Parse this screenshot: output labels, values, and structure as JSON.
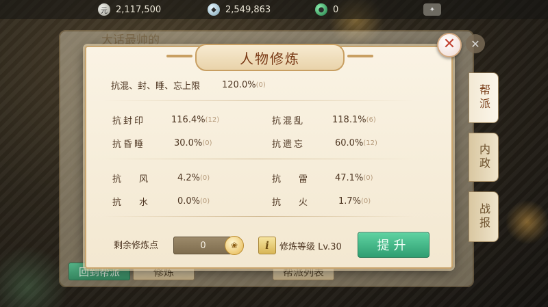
{
  "top_bar": {
    "silver": {
      "icon": "silver-coin-icon",
      "value": "2,117,500"
    },
    "gems": {
      "icon": "gem-icon",
      "value": "2,549,863"
    },
    "jade": {
      "icon": "jade-icon",
      "value": "0"
    }
  },
  "background_panel": {
    "title": "大话最帅的",
    "buttons": [
      "回到帮派",
      "修炼",
      "帮派列表"
    ],
    "side_tabs": [
      {
        "label": "帮派",
        "active": true
      },
      {
        "label": "内政",
        "active": false
      },
      {
        "label": "战报",
        "active": false
      }
    ]
  },
  "dialog": {
    "title": "人物修炼",
    "summary": {
      "label": "抗混、封、睡、忘上限",
      "value": "120.0%",
      "bonus": "(0)"
    },
    "group1": [
      {
        "label": "抗封印",
        "value": "116.4%",
        "bonus": "(12)"
      },
      {
        "label": "抗混乱",
        "value": "118.1%",
        "bonus": "(6)"
      },
      {
        "label": "抗昏睡",
        "value": "30.0%",
        "bonus": "(0)"
      },
      {
        "label": "抗遗忘",
        "value": "60.0%",
        "bonus": "(12)"
      }
    ],
    "group2": [
      {
        "label": "抗　　风",
        "value": "4.2%",
        "bonus": "(0)"
      },
      {
        "label": "抗　　雷",
        "value": "47.1%",
        "bonus": "(0)"
      },
      {
        "label": "抗　　水",
        "value": "0.0%",
        "bonus": "(0)"
      },
      {
        "label": "抗　　火",
        "value": "1.7%",
        "bonus": "(0)"
      }
    ],
    "remaining_points_label": "剩余修炼点",
    "remaining_points_value": "0",
    "info_icon_glyph": "i",
    "level_label": "修炼等级 Lv.30",
    "upgrade_label": "提升",
    "close_glyph": "✕"
  },
  "colors": {
    "accent_green": "#2f9e71",
    "title_brown": "#7a3a16",
    "close_red": "#c24535"
  }
}
